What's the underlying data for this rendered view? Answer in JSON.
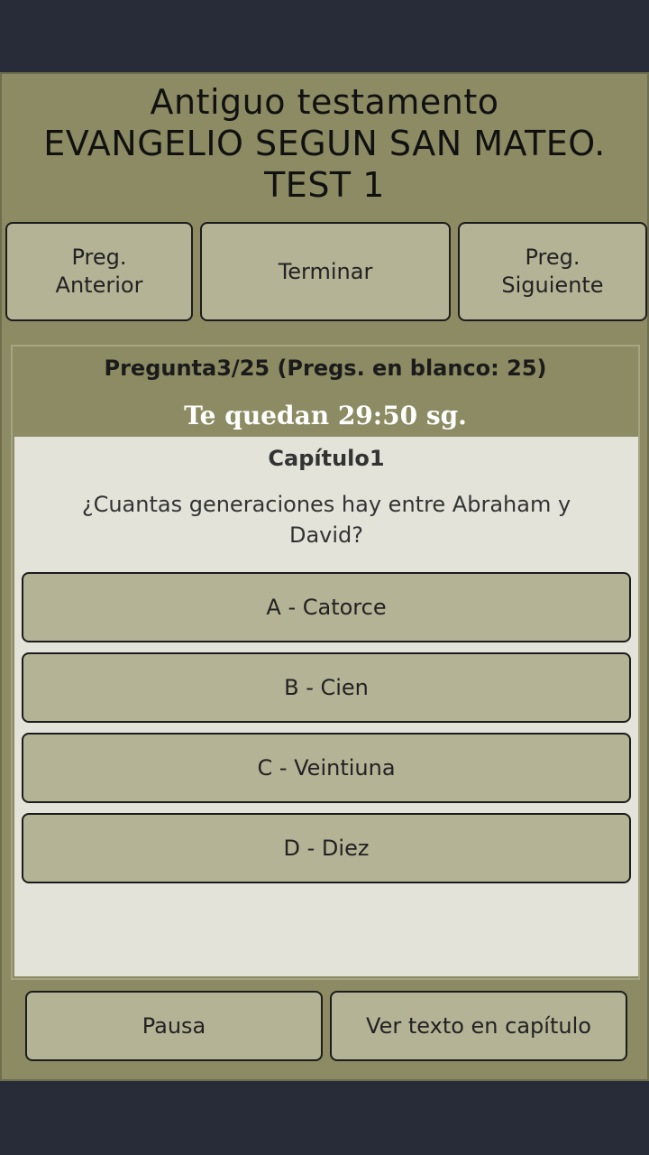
{
  "header": {
    "line1": "Antiguo testamento",
    "line2": "EVANGELIO SEGUN SAN MATEO.",
    "line3": "TEST 1"
  },
  "nav": {
    "prev_line1": "Preg.",
    "prev_line2": "Anterior",
    "end_label": "Terminar",
    "next_line1": "Preg.",
    "next_line2": "Siguiente"
  },
  "quiz": {
    "status": "Pregunta3/25  (Pregs. en blanco: 25)",
    "timer": "Te quedan 29:50 sg.",
    "chapter": "Capítulo1",
    "question": "¿Cuantas generaciones hay entre Abraham y David?",
    "answers": [
      "A - Catorce",
      "B - Cien",
      "C - Veintiuna",
      "D - Diez"
    ]
  },
  "footer": {
    "pause_label": "Pausa",
    "text_label": "Ver texto en capítulo"
  },
  "colors": {
    "background": "#282c38",
    "panel": "#8c8b63",
    "button": "#b5b396",
    "question_area": "#e3e3d9",
    "timer_text": "#ffffff"
  }
}
